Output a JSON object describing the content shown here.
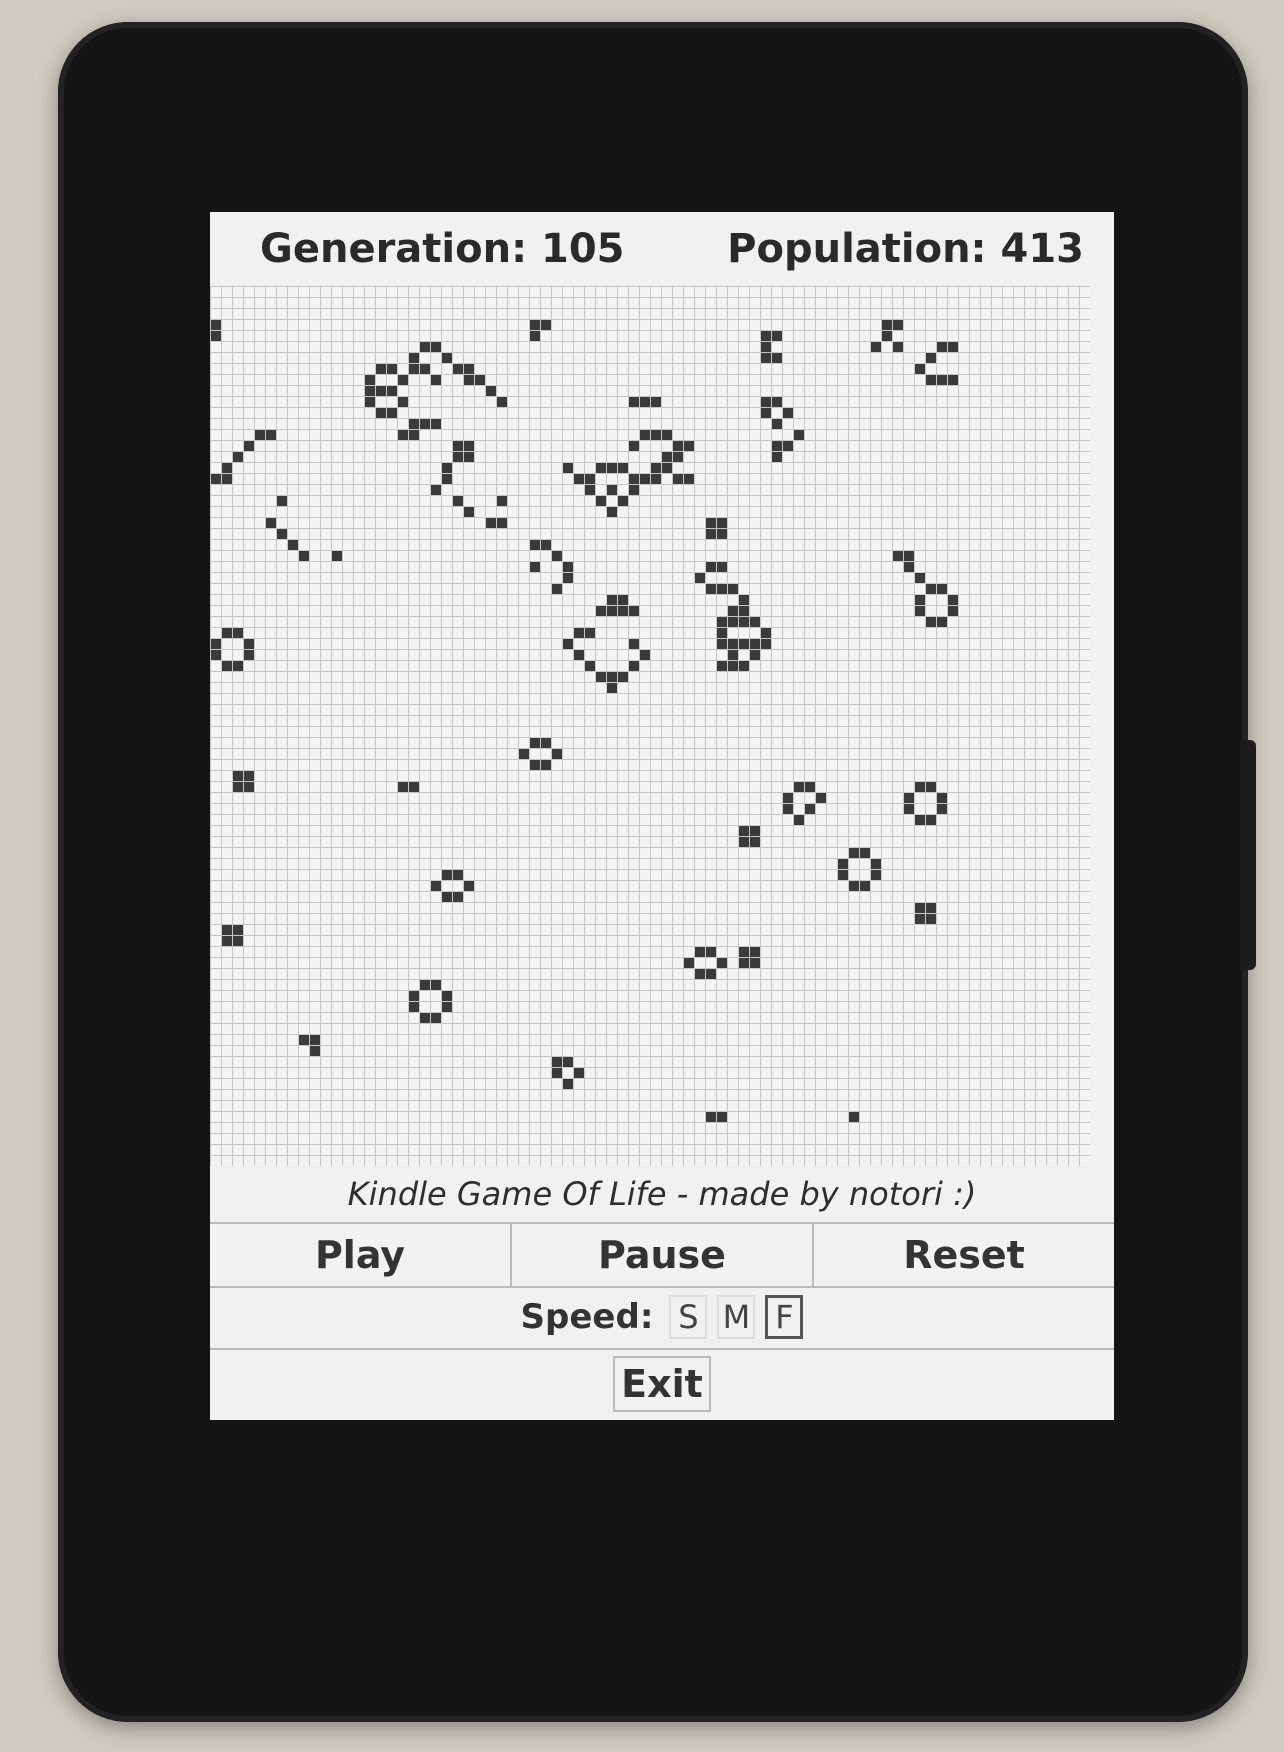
{
  "header": {
    "generation_label": "Generation:",
    "generation_value": "105",
    "population_label": "Population:",
    "population_value": "413"
  },
  "board": {
    "cell_color": "#3a3a3a",
    "grid_line_color": "#c6c6c6",
    "live_cells": [
      [
        0,
        3
      ],
      [
        0,
        4
      ],
      [
        29,
        3
      ],
      [
        30,
        3
      ],
      [
        29,
        4
      ],
      [
        19,
        5
      ],
      [
        20,
        5
      ],
      [
        18,
        6
      ],
      [
        21,
        6
      ],
      [
        18,
        7
      ],
      [
        19,
        7
      ],
      [
        20,
        8
      ],
      [
        15,
        7
      ],
      [
        16,
        7
      ],
      [
        14,
        8
      ],
      [
        17,
        8
      ],
      [
        14,
        9
      ],
      [
        15,
        9
      ],
      [
        16,
        9
      ],
      [
        14,
        10
      ],
      [
        17,
        10
      ],
      [
        15,
        11
      ],
      [
        16,
        11
      ],
      [
        22,
        7
      ],
      [
        23,
        7
      ],
      [
        23,
        8
      ],
      [
        24,
        8
      ],
      [
        25,
        9
      ],
      [
        26,
        10
      ],
      [
        50,
        4
      ],
      [
        51,
        4
      ],
      [
        50,
        5
      ],
      [
        50,
        6
      ],
      [
        51,
        6
      ],
      [
        61,
        3
      ],
      [
        62,
        3
      ],
      [
        61,
        4
      ],
      [
        60,
        5
      ],
      [
        62,
        5
      ],
      [
        66,
        5
      ],
      [
        67,
        5
      ],
      [
        65,
        6
      ],
      [
        64,
        7
      ],
      [
        65,
        8
      ],
      [
        66,
        8
      ],
      [
        67,
        8
      ],
      [
        38,
        10
      ],
      [
        39,
        10
      ],
      [
        40,
        10
      ],
      [
        50,
        10
      ],
      [
        51,
        10
      ],
      [
        50,
        11
      ],
      [
        52,
        11
      ],
      [
        51,
        12
      ],
      [
        53,
        13
      ],
      [
        51,
        14
      ],
      [
        52,
        14
      ],
      [
        51,
        15
      ],
      [
        18,
        12
      ],
      [
        19,
        12
      ],
      [
        20,
        12
      ],
      [
        17,
        13
      ],
      [
        18,
        13
      ],
      [
        22,
        14
      ],
      [
        23,
        14
      ],
      [
        22,
        15
      ],
      [
        23,
        15
      ],
      [
        21,
        16
      ],
      [
        21,
        17
      ],
      [
        20,
        18
      ],
      [
        4,
        13
      ],
      [
        5,
        13
      ],
      [
        3,
        14
      ],
      [
        2,
        15
      ],
      [
        1,
        16
      ],
      [
        0,
        17
      ],
      [
        1,
        17
      ],
      [
        39,
        13
      ],
      [
        40,
        13
      ],
      [
        41,
        13
      ],
      [
        38,
        14
      ],
      [
        42,
        14
      ],
      [
        43,
        14
      ],
      [
        41,
        15
      ],
      [
        42,
        15
      ],
      [
        40,
        16
      ],
      [
        41,
        16
      ],
      [
        39,
        17
      ],
      [
        40,
        17
      ],
      [
        42,
        17
      ],
      [
        43,
        17
      ],
      [
        35,
        16
      ],
      [
        36,
        16
      ],
      [
        37,
        16
      ],
      [
        34,
        17
      ],
      [
        38,
        17
      ],
      [
        34,
        18
      ],
      [
        36,
        18
      ],
      [
        38,
        18
      ],
      [
        35,
        19
      ],
      [
        37,
        19
      ],
      [
        36,
        20
      ],
      [
        32,
        16
      ],
      [
        33,
        17
      ],
      [
        6,
        19
      ],
      [
        5,
        21
      ],
      [
        6,
        22
      ],
      [
        7,
        23
      ],
      [
        8,
        24
      ],
      [
        11,
        24
      ],
      [
        22,
        19
      ],
      [
        26,
        19
      ],
      [
        23,
        20
      ],
      [
        25,
        21
      ],
      [
        26,
        21
      ],
      [
        45,
        21
      ],
      [
        46,
        21
      ],
      [
        45,
        22
      ],
      [
        46,
        22
      ],
      [
        29,
        23
      ],
      [
        30,
        23
      ],
      [
        31,
        24
      ],
      [
        29,
        25
      ],
      [
        32,
        25
      ],
      [
        32,
        26
      ],
      [
        31,
        27
      ],
      [
        45,
        25
      ],
      [
        46,
        25
      ],
      [
        44,
        26
      ],
      [
        45,
        27
      ],
      [
        46,
        27
      ],
      [
        47,
        27
      ],
      [
        48,
        28
      ],
      [
        47,
        29
      ],
      [
        48,
        29
      ],
      [
        62,
        24
      ],
      [
        63,
        24
      ],
      [
        63,
        25
      ],
      [
        64,
        26
      ],
      [
        65,
        27
      ],
      [
        66,
        27
      ],
      [
        64,
        28
      ],
      [
        67,
        28
      ],
      [
        64,
        29
      ],
      [
        67,
        29
      ],
      [
        65,
        30
      ],
      [
        66,
        30
      ],
      [
        36,
        28
      ],
      [
        37,
        28
      ],
      [
        35,
        29
      ],
      [
        36,
        29
      ],
      [
        37,
        29
      ],
      [
        38,
        29
      ],
      [
        33,
        31
      ],
      [
        34,
        31
      ],
      [
        32,
        32
      ],
      [
        38,
        32
      ],
      [
        33,
        33
      ],
      [
        39,
        33
      ],
      [
        34,
        34
      ],
      [
        38,
        34
      ],
      [
        46,
        30
      ],
      [
        47,
        30
      ],
      [
        48,
        30
      ],
      [
        49,
        30
      ],
      [
        46,
        31
      ],
      [
        50,
        31
      ],
      [
        46,
        32
      ],
      [
        47,
        32
      ],
      [
        48,
        32
      ],
      [
        49,
        32
      ],
      [
        50,
        32
      ],
      [
        47,
        33
      ],
      [
        49,
        33
      ],
      [
        46,
        34
      ],
      [
        47,
        34
      ],
      [
        48,
        34
      ],
      [
        35,
        35
      ],
      [
        36,
        35
      ],
      [
        37,
        35
      ],
      [
        36,
        36
      ],
      [
        1,
        31
      ],
      [
        2,
        31
      ],
      [
        0,
        32
      ],
      [
        3,
        32
      ],
      [
        0,
        33
      ],
      [
        3,
        33
      ],
      [
        1,
        34
      ],
      [
        2,
        34
      ],
      [
        29,
        41
      ],
      [
        30,
        41
      ],
      [
        28,
        42
      ],
      [
        31,
        42
      ],
      [
        29,
        43
      ],
      [
        30,
        43
      ],
      [
        2,
        44
      ],
      [
        3,
        44
      ],
      [
        2,
        45
      ],
      [
        3,
        45
      ],
      [
        17,
        45
      ],
      [
        18,
        45
      ],
      [
        53,
        45
      ],
      [
        54,
        45
      ],
      [
        52,
        46
      ],
      [
        55,
        46
      ],
      [
        52,
        47
      ],
      [
        54,
        47
      ],
      [
        53,
        48
      ],
      [
        64,
        45
      ],
      [
        65,
        45
      ],
      [
        63,
        46
      ],
      [
        66,
        46
      ],
      [
        63,
        47
      ],
      [
        66,
        47
      ],
      [
        64,
        48
      ],
      [
        65,
        48
      ],
      [
        48,
        49
      ],
      [
        49,
        49
      ],
      [
        48,
        50
      ],
      [
        49,
        50
      ],
      [
        58,
        51
      ],
      [
        59,
        51
      ],
      [
        57,
        52
      ],
      [
        60,
        52
      ],
      [
        57,
        53
      ],
      [
        60,
        53
      ],
      [
        58,
        54
      ],
      [
        59,
        54
      ],
      [
        21,
        53
      ],
      [
        22,
        53
      ],
      [
        20,
        54
      ],
      [
        23,
        54
      ],
      [
        21,
        55
      ],
      [
        22,
        55
      ],
      [
        64,
        56
      ],
      [
        65,
        56
      ],
      [
        64,
        57
      ],
      [
        65,
        57
      ],
      [
        1,
        58
      ],
      [
        2,
        58
      ],
      [
        1,
        59
      ],
      [
        2,
        59
      ],
      [
        44,
        60
      ],
      [
        45,
        60
      ],
      [
        43,
        61
      ],
      [
        46,
        61
      ],
      [
        44,
        62
      ],
      [
        45,
        62
      ],
      [
        48,
        60
      ],
      [
        49,
        60
      ],
      [
        48,
        61
      ],
      [
        49,
        61
      ],
      [
        19,
        63
      ],
      [
        20,
        63
      ],
      [
        18,
        64
      ],
      [
        21,
        64
      ],
      [
        18,
        65
      ],
      [
        21,
        65
      ],
      [
        19,
        66
      ],
      [
        20,
        66
      ],
      [
        8,
        68
      ],
      [
        9,
        68
      ],
      [
        9,
        69
      ],
      [
        31,
        70
      ],
      [
        32,
        70
      ],
      [
        31,
        71
      ],
      [
        33,
        71
      ],
      [
        32,
        72
      ],
      [
        45,
        75
      ],
      [
        46,
        75
      ],
      [
        58,
        75
      ]
    ]
  },
  "caption": "Kindle Game Of Life - made by notori :)",
  "controls": {
    "play": "Play",
    "pause": "Pause",
    "reset": "Reset"
  },
  "speed": {
    "label": "Speed:",
    "options": [
      "S",
      "M",
      "F"
    ],
    "selected": "F"
  },
  "exit": "Exit"
}
